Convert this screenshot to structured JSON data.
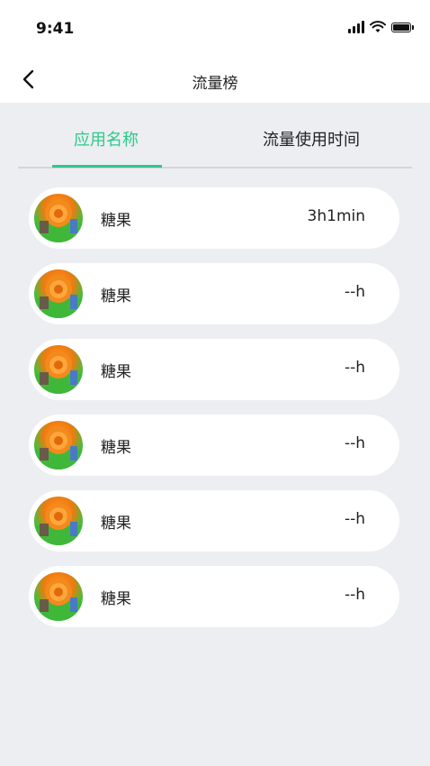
{
  "status_bar": {
    "time": "9:41"
  },
  "navbar": {
    "title": "流量榜"
  },
  "tabs": [
    {
      "label": "应用名称",
      "active": true
    },
    {
      "label": "流量使用时间",
      "active": false
    }
  ],
  "colors": {
    "accent": "#2fc98a",
    "background": "#eceef2",
    "card": "#ffffff"
  },
  "list": [
    {
      "name": "糖果",
      "time": "3h1min"
    },
    {
      "name": "糖果",
      "time": "--h"
    },
    {
      "name": "糖果",
      "time": "--h"
    },
    {
      "name": "糖果",
      "time": "--h"
    },
    {
      "name": "糖果",
      "time": "--h"
    },
    {
      "name": "糖果",
      "time": "--h"
    }
  ]
}
